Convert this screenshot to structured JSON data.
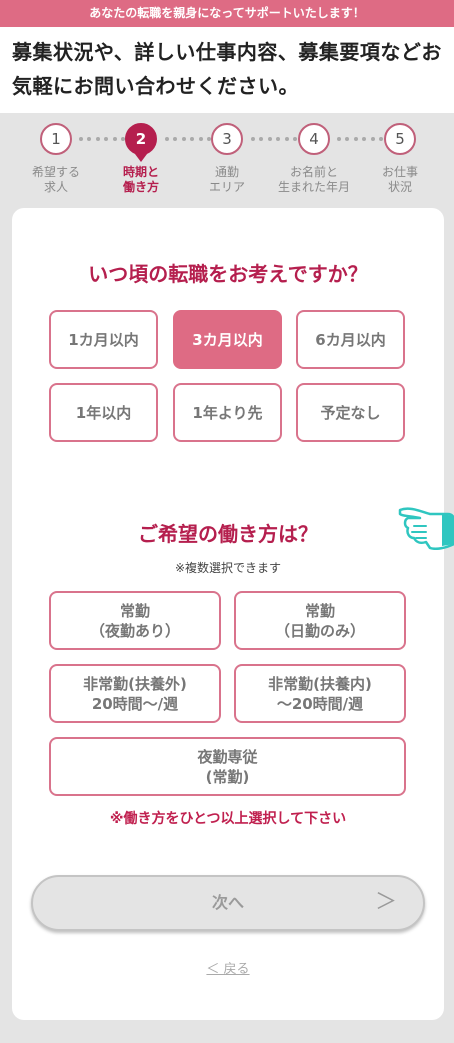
{
  "topbar": {
    "text": "あなたの転職を親身になってサポートいたします！"
  },
  "headline": {
    "text": "募集状況や、詳しい仕事内容、募集要項などお気軽にお問い合わせください。"
  },
  "steps": [
    {
      "number": "1",
      "label": "希望する\n求人",
      "active": false
    },
    {
      "number": "2",
      "label": "時期と\n働き方",
      "active": true
    },
    {
      "number": "3",
      "label": "通勤\nエリア",
      "active": false
    },
    {
      "number": "4",
      "label": "お名前と\n生まれた年月",
      "active": false
    },
    {
      "number": "5",
      "label": "お仕事\n状況",
      "active": false
    }
  ],
  "timing": {
    "title": "いつ頃の転職をお考えですか？",
    "options": [
      {
        "label": "1カ月以内",
        "selected": false
      },
      {
        "label": "3カ月以内",
        "selected": true
      },
      {
        "label": "6カ月以内",
        "selected": false
      },
      {
        "label": "1年以内",
        "selected": false
      },
      {
        "label": "1年より先",
        "selected": false
      },
      {
        "label": "予定なし",
        "selected": false
      }
    ]
  },
  "workstyle": {
    "title": "ご希望の働き方は？",
    "note": "※複数選択できます",
    "options": [
      {
        "label": "常勤\n（夜勤あり）",
        "selected": false
      },
      {
        "label": "常勤\n（日勤のみ）",
        "selected": false
      },
      {
        "label": "非常勤(扶養外)\n20時間〜/週",
        "selected": false
      },
      {
        "label": "非常勤(扶養内)\n〜20時間/週",
        "selected": false
      },
      {
        "label": "夜勤専従\n(常勤)",
        "selected": false
      }
    ],
    "error": "※働き方をひとつ以上選択して下さい"
  },
  "next_button": {
    "label": "次へ",
    "arrow": "＞"
  },
  "back_link": {
    "label": "＜ 戻る"
  },
  "colors": {
    "accent": "#de6b84",
    "primary": "#b51f4e",
    "hand": "#2fc6c0"
  },
  "icons": {
    "hand": "pointing-hand-icon"
  }
}
